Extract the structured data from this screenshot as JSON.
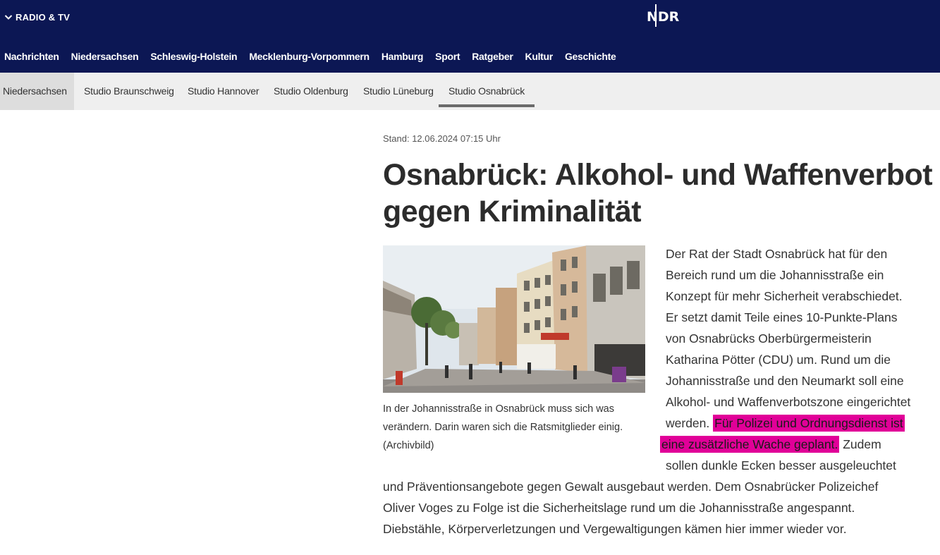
{
  "header": {
    "radio_tv_label": "RADIO & TV",
    "logo_text": "NDR",
    "nav": [
      "Nachrichten",
      "Niedersachsen",
      "Schleswig-Holstein",
      "Mecklenburg-Vorpommern",
      "Hamburg",
      "Sport",
      "Ratgeber",
      "Kultur",
      "Geschichte"
    ]
  },
  "subnav": {
    "home": "Niedersachsen",
    "items": [
      "Studio Braunschweig",
      "Studio Hannover",
      "Studio Oldenburg",
      "Studio Lüneburg",
      "Studio Osnabrück"
    ],
    "active": "Studio Osnabrück"
  },
  "article": {
    "stand": "Stand: 12.06.2024 07:15 Uhr",
    "headline_line1": "Osnabrück: Alkohol- und Waffenverbot",
    "headline_line2": "gegen Kriminalität",
    "caption": "In der Johannisstraße in Osnabrück muss sich was verändern. Darin waren sich die Ratsmitglieder einig. (Archivbild)",
    "lines": [
      "Der Rat der Stadt Osnabrück hat für den",
      "Bereich rund um die Johannisstraße ein",
      "Konzept für mehr Sicherheit verabschiedet.",
      "Er setzt damit Teile eines 10-Punkte-Plans",
      "von Osnabrücks Oberbürgermeisterin",
      "Katharina Pötter (CDU) um. Rund um die",
      "Johannisstraße und den Neumarkt soll eine",
      "Alkohol- und Waffenverbotszone eingerichtet"
    ],
    "line9_pre": "werden. ",
    "line9_highlight": "Für Polizei und Ordnungsdienst ist",
    "line10_highlight": "eine zusätzliche Wache geplant.",
    "line10_post": " Zudem",
    "line11": "sollen dunkle Ecken besser ausgeleuchtet",
    "line12": "und Präventionsangebote gegen Gewalt ausgebaut werden. Dem Osnabrücker Polizeichef",
    "line13": "Oliver Voges zu Folge ist die Sicherheitslage rund um die Johannisstraße angespannt.",
    "line14": "Diebstähle, Körperverletzungen und Vergewaltigungen kämen hier immer wieder vor.",
    "highlight_color": "#e10098"
  }
}
